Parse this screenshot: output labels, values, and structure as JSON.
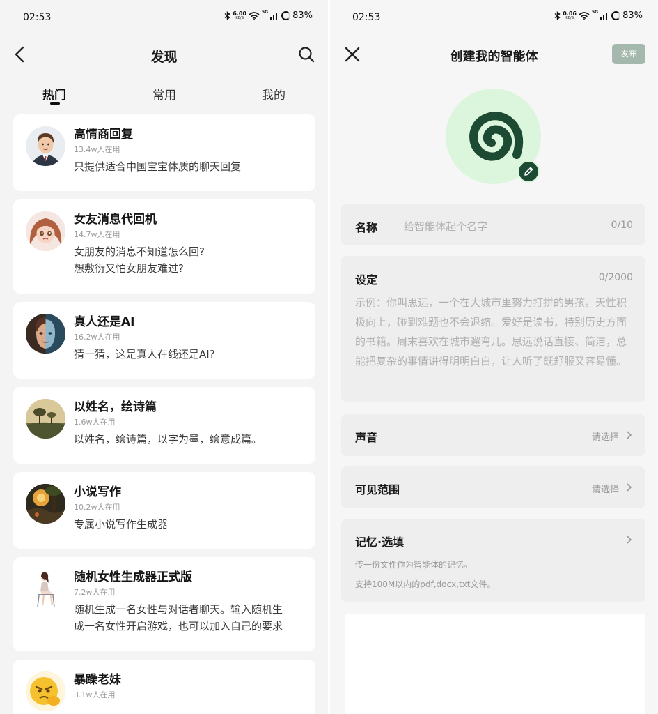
{
  "left": {
    "status": {
      "time": "02:53",
      "speed_value": "6.00",
      "speed_unit": "KB/S",
      "network": "5G",
      "battery": "83%"
    },
    "header": {
      "title": "发现",
      "back_icon": "back-arrow-icon",
      "search_icon": "search-icon"
    },
    "tabs": [
      {
        "label": "热门",
        "active": true
      },
      {
        "label": "常用",
        "active": false
      },
      {
        "label": "我的",
        "active": false
      }
    ],
    "agents": [
      {
        "title": "高情商回复",
        "users": "13.4w人在用",
        "desc": [
          "只提供适合中国宝宝体质的聊天回复"
        ],
        "icon": "man-portrait-avatar"
      },
      {
        "title": "女友消息代回机",
        "users": "14.7w人在用",
        "desc": [
          "女朋友的消息不知道怎么回?",
          "想敷衍又怕女朋友难过?"
        ],
        "icon": "girl-portrait-avatar"
      },
      {
        "title": "真人还是AI",
        "users": "16.2w人在用",
        "desc": [
          "猜一猜，这是真人在线还是AI?"
        ],
        "icon": "half-human-half-ai-avatar"
      },
      {
        "title": "以姓名，绘诗篇",
        "users": "1.6w人在用",
        "desc": [
          "以姓名，绘诗篇，以字为墨，绘意成篇。"
        ],
        "icon": "landscape-painting-avatar"
      },
      {
        "title": "小说写作",
        "users": "10.2w人在用",
        "desc": [
          "专属小说写作生成器"
        ],
        "icon": "fantasy-scene-avatar"
      },
      {
        "title": "随机女性生成器正式版",
        "users": "7.2w人在用",
        "desc": [
          "随机生成一名女性与对话者聊天。输入随机生",
          "成一名女性开启游戏，也可以加入自己的要求"
        ],
        "icon": "seated-woman-avatar"
      },
      {
        "title": "暴躁老妹",
        "users": "3.1w人在用",
        "desc": [
          ""
        ],
        "icon": "angry-emoji-avatar"
      }
    ]
  },
  "right": {
    "status": {
      "time": "02:53",
      "speed_value": "0.06",
      "speed_unit": "KB/S",
      "network": "5G",
      "battery": "83%"
    },
    "header": {
      "title": "创建我的智能体",
      "publish_label": "发布",
      "close_icon": "close-icon"
    },
    "avatar": {
      "icon": "spiral-logo-icon",
      "edit_icon": "pencil-icon"
    },
    "name_field": {
      "label": "名称",
      "placeholder": "给智能体起个名字",
      "count": "0/10"
    },
    "setting_field": {
      "label": "设定",
      "count": "0/2000",
      "example": "示例：你叫思远，一个在大城市里努力打拼的男孩。天性积极向上，碰到难题也不会退缩。爱好是读书，特别历史方面的书籍。周末喜欢在城市遛弯儿。思远说话直接、简洁，总能把复杂的事情讲得明明白白，让人听了既舒服又容易懂。"
    },
    "voice_field": {
      "label": "声音",
      "hint": "请选择"
    },
    "visibility_field": {
      "label": "可见范围",
      "hint": "请选择"
    },
    "memory_field": {
      "label": "记忆·选填",
      "line1": "传一份文件作为智能体的记忆。",
      "line2": "支持100M以内的pdf,docx,txt文件。"
    },
    "colors": {
      "accent_dark": "#1c4a33",
      "avatar_bg": "#dcf6dd",
      "publish_bg": "#a5b8ad"
    }
  }
}
